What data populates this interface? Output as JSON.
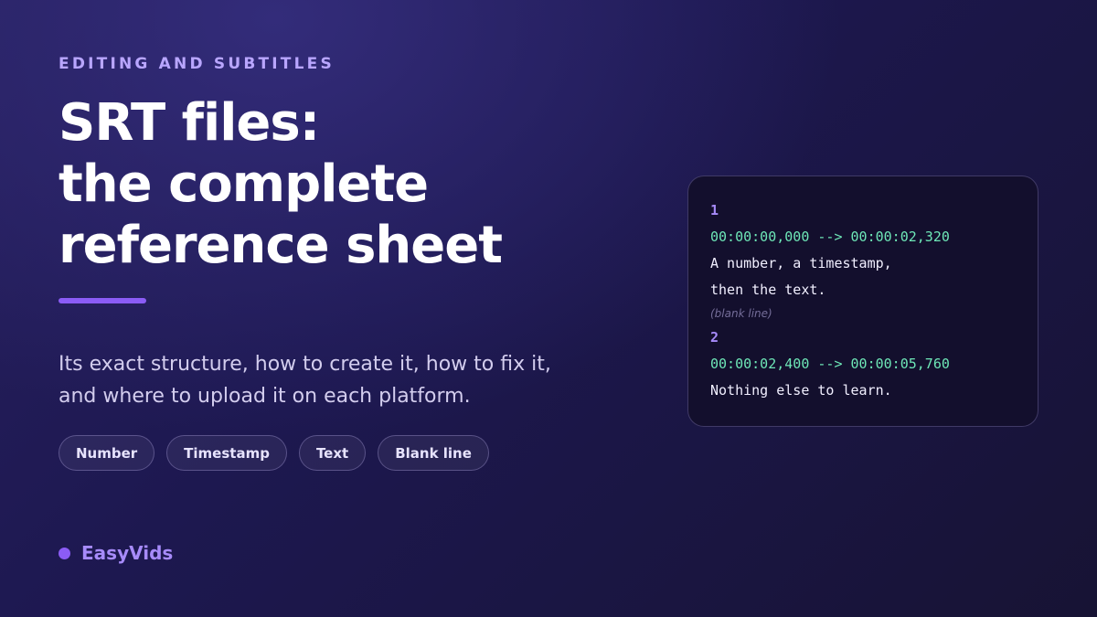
{
  "eyebrow": "EDITING AND SUBTITLES",
  "title": {
    "line1": "SRT files:",
    "line2": "the complete",
    "line3": "reference sheet"
  },
  "description": {
    "line1": "Its exact structure, how to create it, how to fix it,",
    "line2": "and where to upload it on each platform."
  },
  "tags": [
    "Number",
    "Timestamp",
    "Text",
    "Blank line"
  ],
  "brand": {
    "name": "EasyVids"
  },
  "code_sample": {
    "entry1_number": "1",
    "entry1_timestamp": "00:00:00,000 --> 00:00:02,320",
    "entry1_text_line1": "A number, a timestamp,",
    "entry1_text_line2": "then the text.",
    "blank_line_note": "(blank line)",
    "entry2_number": "2",
    "entry2_timestamp": "00:00:02,400 --> 00:00:05,760",
    "entry2_text_line1": "Nothing else to learn."
  },
  "colors": {
    "accent": "#8b5cf6",
    "eyebrow": "#b9a6ff",
    "timestamp": "#6ee7b7",
    "background": "#1d1850"
  }
}
